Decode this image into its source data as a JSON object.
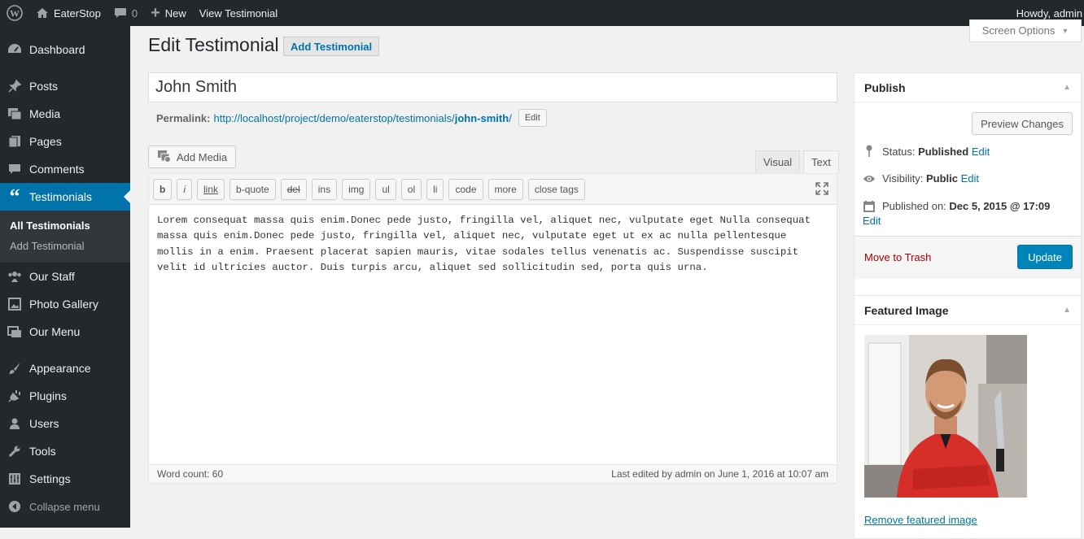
{
  "adminbar": {
    "site_name": "EaterStop",
    "comments_count": "0",
    "new_label": "New",
    "view_label": "View Testimonial",
    "howdy": "Howdy, admin"
  },
  "sidebar": {
    "items": [
      {
        "label": "Dashboard",
        "icon": "dashboard-icon"
      },
      {
        "label": "Posts",
        "icon": "pin-icon"
      },
      {
        "label": "Media",
        "icon": "media-icon"
      },
      {
        "label": "Pages",
        "icon": "pages-icon"
      },
      {
        "label": "Comments",
        "icon": "comment-icon"
      },
      {
        "label": "Testimonials",
        "icon": "quote-icon"
      },
      {
        "label": "Our Staff",
        "icon": "groups-icon"
      },
      {
        "label": "Photo Gallery",
        "icon": "gallery-icon"
      },
      {
        "label": "Our Menu",
        "icon": "menu-icon"
      },
      {
        "label": "Appearance",
        "icon": "brush-icon"
      },
      {
        "label": "Plugins",
        "icon": "plugin-icon"
      },
      {
        "label": "Users",
        "icon": "user-icon"
      },
      {
        "label": "Tools",
        "icon": "wrench-icon"
      },
      {
        "label": "Settings",
        "icon": "settings-icon"
      }
    ],
    "submenu": [
      "All Testimonials",
      "Add Testimonial"
    ],
    "collapse": "Collapse menu"
  },
  "main": {
    "screen_options": "Screen Options",
    "page_title": "Edit Testimonial",
    "add_new": "Add Testimonial",
    "title_value": "John Smith",
    "permalink_label": "Permalink:",
    "permalink_base": "http://localhost/project/demo/eaterstop/testimonials/",
    "permalink_slug": "john-smith",
    "permalink_end": "/",
    "permalink_edit": "Edit",
    "add_media": "Add Media",
    "tabs": {
      "visual": "Visual",
      "text": "Text"
    },
    "quicktags": [
      "b",
      "i",
      "link",
      "b-quote",
      "del",
      "ins",
      "img",
      "ul",
      "ol",
      "li",
      "code",
      "more",
      "close tags"
    ],
    "content": "Lorem consequat massa quis enim.Donec pede justo, fringilla vel, aliquet nec, vulputate eget Nulla consequat massa quis enim.Donec pede justo, fringilla vel, aliquet nec, vulputate eget ut ex ac nulla pellentesque mollis in a enim. Praesent placerat sapien mauris, vitae sodales tellus venenatis ac. Suspendisse suscipit velit id ultricies auctor. Duis turpis arcu, aliquet sed sollicitudin sed, porta quis urna.",
    "word_count": "Word count: 60",
    "last_edited": "Last edited by admin on June 1, 2016 at 10:07 am"
  },
  "publish": {
    "title": "Publish",
    "preview": "Preview Changes",
    "status_label": "Status:",
    "status_value": "Published",
    "visibility_label": "Visibility:",
    "visibility_value": "Public",
    "published_label": "Published on:",
    "published_value": "Dec 5, 2015 @ 17:09",
    "edit": "Edit",
    "trash": "Move to Trash",
    "update": "Update"
  },
  "featured": {
    "title": "Featured Image",
    "remove": "Remove featured image"
  },
  "colors": {
    "accent": "#0073aa",
    "adminbar": "#23282d",
    "sidebar": "#23282d",
    "submenu": "#32373c",
    "update": "#0085ba",
    "trash": "#a00"
  }
}
